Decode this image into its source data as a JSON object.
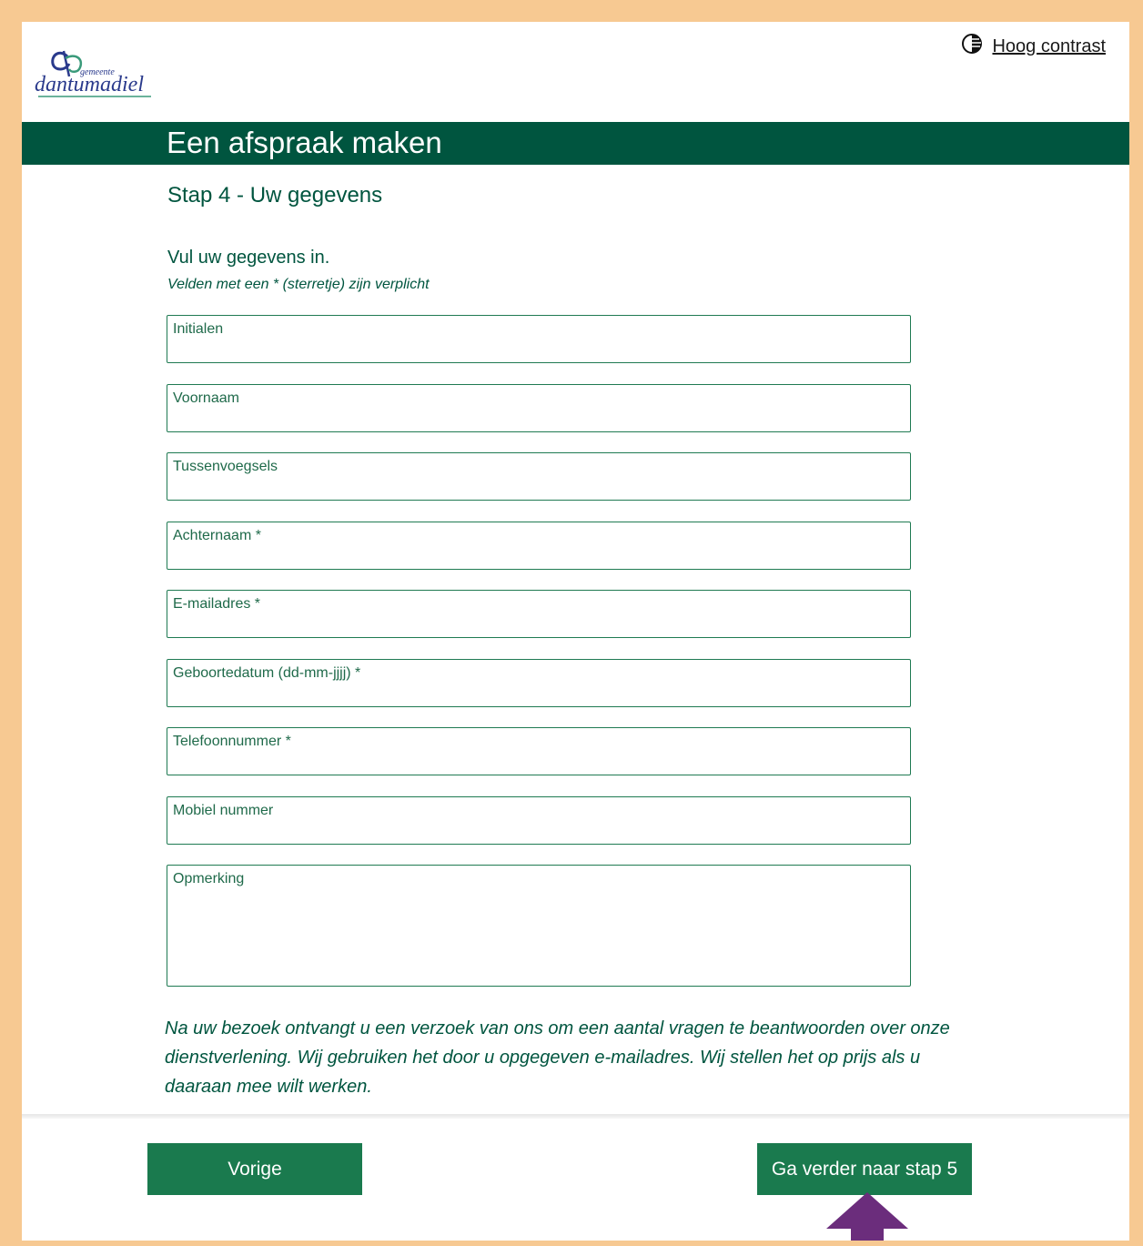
{
  "header": {
    "logo": {
      "brand_small": "gemeente",
      "brand_name": "dantumadiel"
    },
    "contrast_label": "Hoog contrast",
    "contrast_icon": "half-circle-contrast-icon"
  },
  "page": {
    "banner_title": "Een afspraak maken",
    "step_title": "Stap 4 - Uw gegevens",
    "intro": "Vul uw gegevens in.",
    "required_note": "Velden met een * (sterretje) zijn verplicht"
  },
  "form": {
    "fields": [
      {
        "label": "Initialen",
        "value": ""
      },
      {
        "label": "Voornaam",
        "value": ""
      },
      {
        "label": "Tussenvoegsels",
        "value": ""
      },
      {
        "label": "Achternaam *",
        "value": ""
      },
      {
        "label": "E-mailadres *",
        "value": ""
      },
      {
        "label": "Geboortedatum (dd-mm-jjjj) *",
        "value": ""
      },
      {
        "label": "Telefoonnummer *",
        "value": ""
      },
      {
        "label": "Mobiel nummer",
        "value": ""
      },
      {
        "label": "Opmerking",
        "value": ""
      }
    ]
  },
  "notice": "Na uw bezoek ontvangt u een verzoek van ons om een aantal vragen te beantwoorden over onze dienstverlening. Wij gebruiken het door u opgegeven e-mailadres. Wij stellen het op prijs als u daaraan mee wilt werken.",
  "buttons": {
    "previous": "Vorige",
    "next": "Ga verder naar stap 5"
  },
  "colors": {
    "page_border": "#f7c992",
    "brand_green": "#00553f",
    "button_green": "#1a7a4e",
    "arrow_purple": "#6b2d7c"
  }
}
